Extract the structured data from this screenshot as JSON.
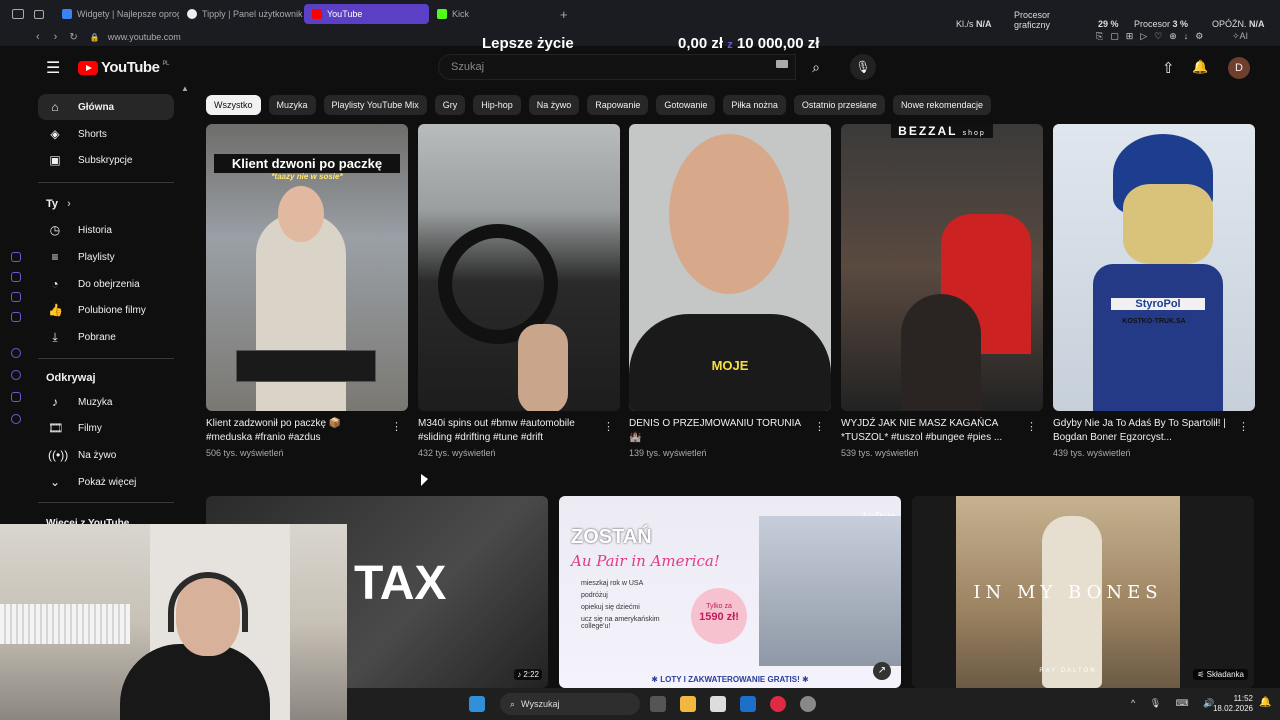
{
  "browser": {
    "tabs": [
      {
        "label": "Widgety | Najlepsze oprog",
        "icon": "widget-icon",
        "color": "#3b82f6"
      },
      {
        "label": "Tipply | Panel użytkownik",
        "icon": "tipply-icon",
        "color": "#eeeeee"
      },
      {
        "label": "YouTube",
        "icon": "youtube-icon",
        "color": "#ff0000"
      },
      {
        "label": "Kick",
        "icon": "kick-icon",
        "color": "#53fc18"
      }
    ],
    "url": "www.youtube.com",
    "accent": "#5b3fc4"
  },
  "overlay": {
    "goal_title": "Lepsze życie",
    "goal_current": "0,00 zł",
    "goal_sep": "z",
    "goal_target": "10 000,00 zł",
    "klps_label": "Kl./s",
    "klps_value": "N/A",
    "gpu_label": "Procesor graficzny",
    "gpu_percent": "29 %",
    "cpu_label": "Procesor",
    "cpu_percent": "3 %",
    "delay_label": "OPÓŹN.",
    "delay_value": "N/A"
  },
  "header": {
    "logo": "YouTube",
    "logo_region": "PL",
    "search_placeholder": "Szukaj",
    "avatar_letter": "D"
  },
  "nav": {
    "main": [
      {
        "label": "Główna",
        "icon": "home-icon",
        "active": true
      },
      {
        "label": "Shorts",
        "icon": "shorts-icon"
      },
      {
        "label": "Subskrypcje",
        "icon": "subscriptions-icon"
      }
    ],
    "you_heading": "Ty",
    "you": [
      {
        "label": "Historia",
        "icon": "history-icon"
      },
      {
        "label": "Playlisty",
        "icon": "playlist-icon"
      },
      {
        "label": "Do obejrzenia",
        "icon": "watch-later-icon"
      },
      {
        "label": "Polubione filmy",
        "icon": "like-icon"
      },
      {
        "label": "Pobrane",
        "icon": "download-icon"
      }
    ],
    "explore_heading": "Odkrywaj",
    "explore": [
      {
        "label": "Muzyka",
        "icon": "music-icon"
      },
      {
        "label": "Filmy",
        "icon": "film-icon"
      },
      {
        "label": "Na żywo",
        "icon": "live-icon"
      },
      {
        "label": "Pokaż więcej",
        "icon": "chevron-down-icon"
      }
    ],
    "more_heading": "Więcej z YouTube"
  },
  "chips": [
    "Wszystko",
    "Muzyka",
    "Playlisty YouTube Mix",
    "Gry",
    "Hip-hop",
    "Na żywo",
    "Rapowanie",
    "Gotowanie",
    "Piłka nożna",
    "Ostatnio przesłane",
    "Nowe rekomendacje"
  ],
  "videos": [
    {
      "title": "Klient zadzwonił po paczkę 📦 #meduska #franio #azdus",
      "views": "506 tys. wyświetleń",
      "thumb_text": "Klient dzwoni po paczkę",
      "thumb_sub": "*taazy nie w sosie*"
    },
    {
      "title": "M340i spins out #bmw #automobile #sliding #drifting #tune #drift",
      "views": "432 tys. wyświetleń",
      "thumb_text": "",
      "thumb_sub": ""
    },
    {
      "title": "DENIS O PRZEJMOWANIU TORUNIA 🏰",
      "views": "139 tys. wyświetleń",
      "thumb_text": "MOJE",
      "thumb_sub": ""
    },
    {
      "title": "WYJDŹ JAK NIE MASZ KAGAŃCA *TUSZOL* #tuszol #bungee #pies ...",
      "views": "539 tys. wyświetleń",
      "thumb_text": "BEZZAL",
      "thumb_sub": "shop"
    },
    {
      "title": "Gdyby Nie Ja To Adaś By To Spartolił! | Bogdan Boner Egzorcyst...",
      "views": "439 tys. wyświetleń",
      "thumb_text": "StyroPol",
      "thumb_sub": "KOSTKO-TRUK.SA"
    }
  ],
  "row2": [
    {
      "text": "TAX",
      "duration": "2:22"
    },
    {
      "text": "ZOSTAŃ",
      "sub": "Au Pair in America!",
      "bullets": [
        "mieszkaj rok w USA",
        "podróżuj",
        "opiekuj się dziećmi",
        "ucz się na amerykańskim college'u!"
      ],
      "price_label": "Tylko za",
      "price": "1590 zł!",
      "footer": "✱ LOTY I ZAKWATEROWANIE GRATIS! ✱",
      "brand": "AuPair"
    },
    {
      "text": "IN MY BONES",
      "sub": "RAY DALTON",
      "badge": "Składanka"
    }
  ],
  "taskbar": {
    "search": "Wyszukaj",
    "time": "11:52",
    "date": "18.02.2026"
  }
}
